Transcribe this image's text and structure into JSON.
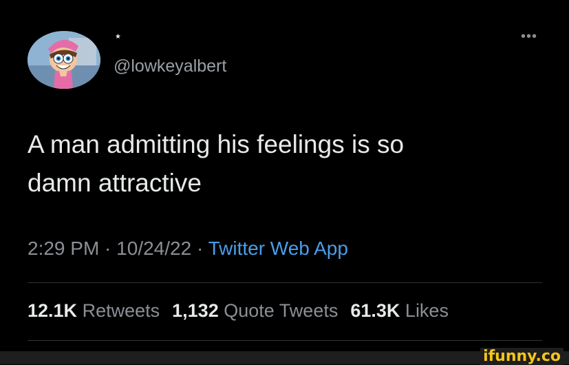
{
  "profile": {
    "verified_mark": "★",
    "handle": "@lowkeyalbert"
  },
  "menu": {
    "more": "•••"
  },
  "tweet": {
    "text": "A man admitting his feelings is so\ndamn attractive"
  },
  "meta": {
    "time": "2:29 PM",
    "sep1": " · ",
    "date": "10/24/22",
    "sep2": " · ",
    "app": "Twitter Web App"
  },
  "stats": {
    "retweets_count": "12.1K",
    "retweets_label": "Retweets",
    "quotes_count": "1,132",
    "quotes_label": "Quote Tweets",
    "likes_count": "61.3K",
    "likes_label": "Likes"
  },
  "watermark": {
    "text": "ifunny.co"
  },
  "colors": {
    "background": "#000000",
    "text": "#e7e9ea",
    "muted": "#8b9096",
    "link": "#4a9eea",
    "divider": "#2f3336",
    "watermark": "#f5c518"
  }
}
